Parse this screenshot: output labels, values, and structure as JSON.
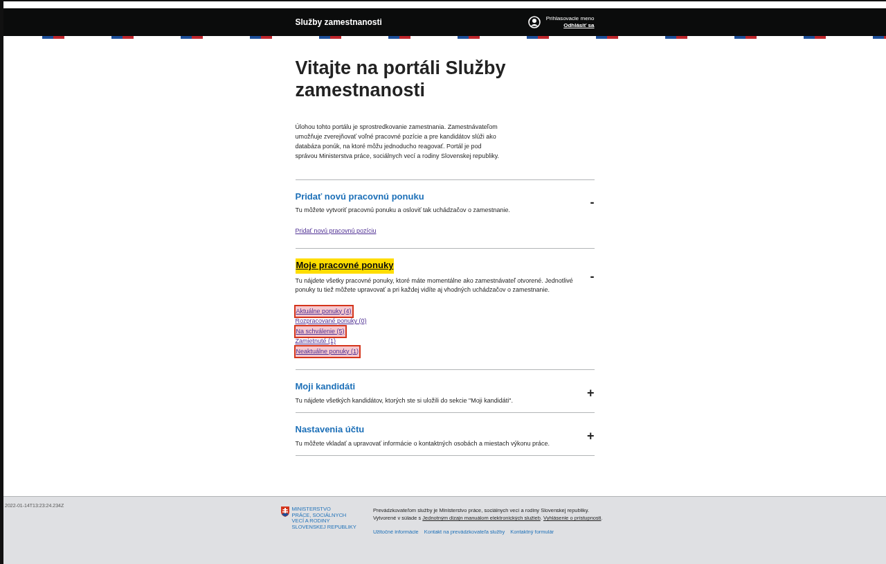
{
  "header": {
    "title": "Služby zamestnanosti",
    "username": "Prihlasovacie meno",
    "logout": "Odhlásiť sa"
  },
  "page_title": "Vitajte na portáli Služby zamestnanosti",
  "intro": "Úlohou tohto portálu je sprostredkovanie zamestnania. Zamestnávateľom umožňuje zverejňovať voľné pracovné pozície a pre kandidátov slúži ako databáza ponúk, na ktoré môžu jednoducho reagovať. Portál je pod správou Ministerstva práce, sociálnych vecí a rodiny Slovenskej republiky.",
  "sections": [
    {
      "title": "Pridať novú pracovnú ponuku",
      "focused": false,
      "toggle": "-",
      "description": "Tu môžete vytvoriť pracovnú ponuku a osloviť tak uchádzačov o zamestnanie.",
      "links": [
        {
          "text": "Pridať novú pracovnú pozíciu",
          "highlighted": false
        }
      ]
    },
    {
      "title": "Moje pracovné ponuky",
      "focused": true,
      "toggle": "-",
      "description": "Tu nájdete všetky pracovné ponuky, ktoré máte momentálne ako zamestnávateľ otvorené. Jednotlivé ponuky tu tiež môžete upravovať a pri každej vidíte aj vhodných uchádzačov o zamestnanie.",
      "links": [
        {
          "text": "Aktuálne ponuky (4)",
          "highlighted": true
        },
        {
          "text": "Rozpracované ponuky (0)",
          "highlighted": false
        },
        {
          "text": "Na schválenie (5)",
          "highlighted": true
        },
        {
          "text": "Zamietnuté (1)",
          "highlighted": false
        },
        {
          "text": "Neaktuálne ponuky (1)",
          "highlighted": true
        }
      ]
    },
    {
      "title": "Moji kandidáti",
      "focused": false,
      "toggle": "+",
      "description": "Tu nájdete všetkých kandidátov, ktorých ste si uložili do sekcie \"Moji kandidáti\"."
    },
    {
      "title": "Nastavenia účtu",
      "focused": false,
      "toggle": "+",
      "description": "Tu môžete vkladať a upravovať informácie o kontaktných osobách a miestach výkonu práce."
    }
  ],
  "footer": {
    "timestamp": "2022-01-14T13:23:24.234Z",
    "logo_lines": [
      "MINISTERSTVO",
      "PRÁCE, SOCIÁLNYCH",
      "VECÍ A RODINY",
      "SLOVENSKEJ REPUBLIKY"
    ],
    "text_parts": [
      {
        "kind": "text",
        "text": "Prevádzkovateľom služby je Ministerstvo práce, sociálnych vecí a rodiny Slovenskej republiky. Vytvorené v súlade s "
      },
      {
        "kind": "link",
        "text": "Jednotným dizajn manuálom elektronických služieb"
      },
      {
        "kind": "text",
        "text": ". "
      },
      {
        "kind": "link",
        "text": "Vyhlásenie o prístupnosti"
      },
      {
        "kind": "text",
        "text": "."
      }
    ],
    "links": [
      "Užitočné informácie",
      "Kontakt na prevádzkovateľa služby",
      "Kontaktný formulár"
    ]
  }
}
